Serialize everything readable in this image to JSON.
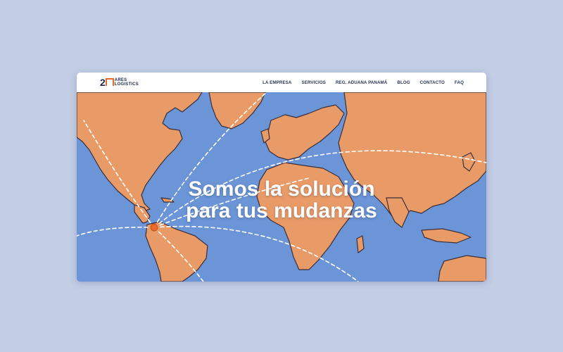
{
  "logo": {
    "number": "2",
    "line1": "ARES",
    "line2": "LOGISTICS"
  },
  "nav": {
    "items": [
      {
        "label": "LA EMPRESA"
      },
      {
        "label": "SERVICIOS"
      },
      {
        "label": "REG. ADUANA PANAMÁ"
      },
      {
        "label": "BLOG"
      },
      {
        "label": "CONTACTO"
      },
      {
        "label": "FAQ"
      }
    ]
  },
  "hero": {
    "headline_line1": "Somos la solución",
    "headline_line2": "para tus mudanzas"
  },
  "colors": {
    "background": "#c3cee5",
    "ocean": "#6b95d6",
    "land": "#e99b67",
    "accent": "#e86a2a",
    "nav_text": "#2a3655"
  }
}
